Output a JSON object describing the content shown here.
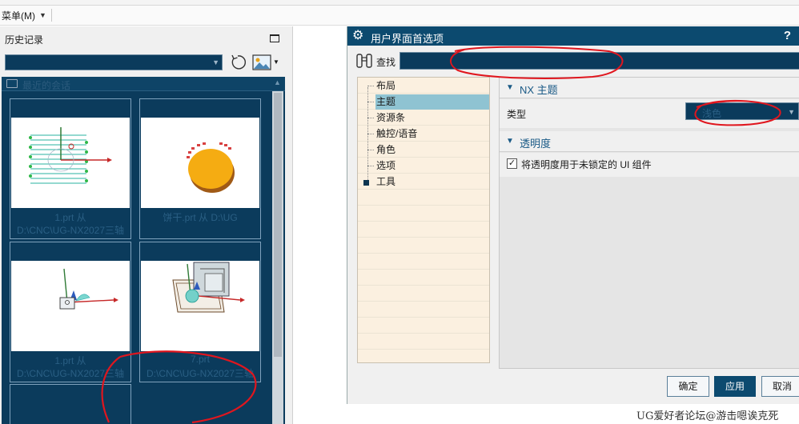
{
  "menubar": {
    "menu_label": "菜单(M)"
  },
  "history": {
    "title": "历史记录",
    "group_label": "最近的会话",
    "tiles": [
      {
        "line1": "1.prt   从",
        "line2": "D:\\CNC\\UG-NX2027三轴"
      },
      {
        "line1": "饼干.prt   从 D:\\UG",
        "line2": ""
      },
      {
        "line1": "1.prt   从",
        "line2": "D:\\CNC\\UG-NX2027三轴"
      },
      {
        "line1": "7.prt",
        "line2": "D:\\CNC\\UG-NX2027三轴"
      }
    ]
  },
  "dialog": {
    "title": "用户界面首选项",
    "help": "?",
    "find_label": "查找",
    "find_value": "",
    "tree": [
      "布局",
      "主题",
      "资源条",
      "触控/语音",
      "角色",
      "选项",
      "工具"
    ],
    "selected_index": 1,
    "nx_theme_section": "NX 主题",
    "type_label": "类型",
    "type_value": "浅色",
    "transparency_section": "透明度",
    "transparency_checkbox_label": "将透明度用于未锁定的 UI 组件",
    "transparency_checked": true,
    "buttons": {
      "ok": "确定",
      "apply": "应用",
      "cancel": "取消"
    }
  },
  "watermark": "UG爱好者论坛@游击嗯诶克死",
  "colors": {
    "accent": "#0c4a6f",
    "annotation": "#e0161e",
    "list_bg": "#0b3b5c",
    "tree_bg": "#fbf0e0",
    "selection": "#8fc3d2"
  },
  "icons": [
    "maximize-icon",
    "refresh-icon",
    "image-icon",
    "folder-icon",
    "gear-icon",
    "binoculars-icon",
    "chevron-down-icon",
    "collapse-triangle-icon"
  ]
}
